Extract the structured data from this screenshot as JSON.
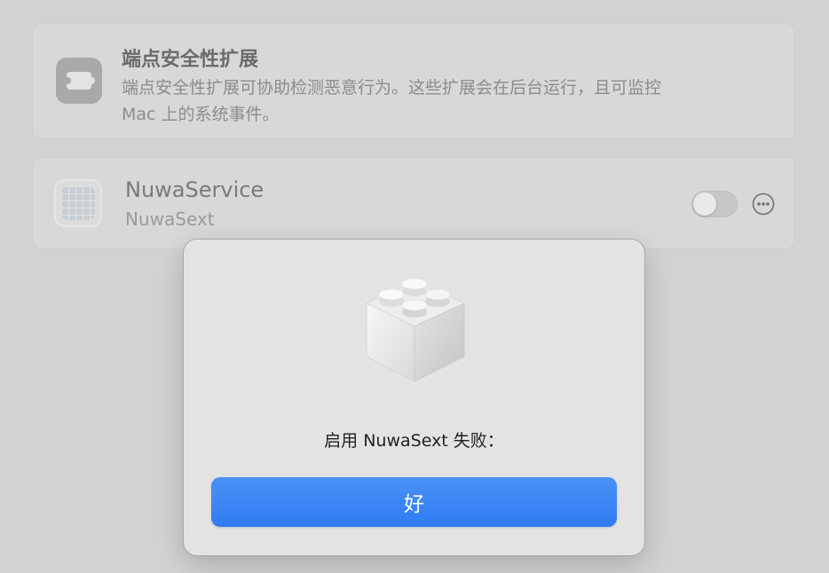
{
  "header": {
    "title": "端点安全性扩展",
    "description_line1": "端点安全性扩展可协助检测恶意行为。这些扩展会在后台运行，且可监控",
    "description_line2": "Mac 上的系统事件。",
    "icon": "puzzle-piece-icon"
  },
  "extension": {
    "name": "NuwaService",
    "identifier": "NuwaSext",
    "icon": "app-grid-icon",
    "enabled": false
  },
  "dialog": {
    "icon": "system-extension-lego-icon",
    "message": "启用 NuwaSext 失败：",
    "ok_label": "好"
  },
  "colors": {
    "accent": "#2f7cf4",
    "background": "#d2d2d2"
  }
}
